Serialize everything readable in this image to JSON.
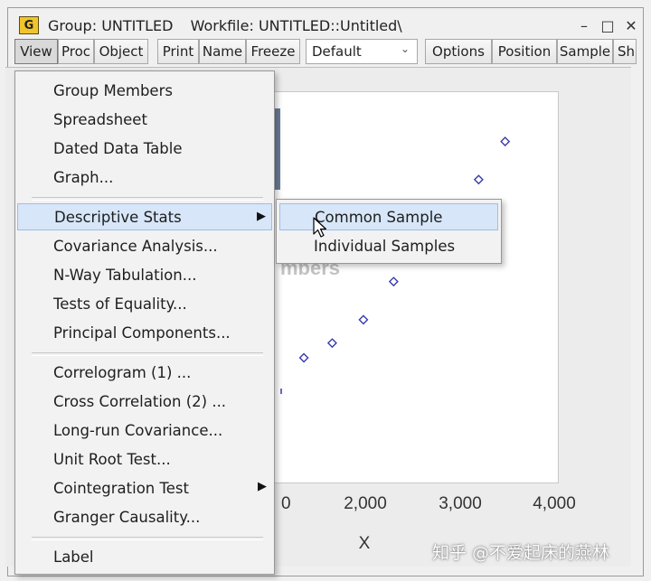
{
  "window": {
    "app_icon_letter": "G",
    "group_title": "Group: UNTITLED",
    "workfile_title": "Workfile: UNTITLED::Untitled\\",
    "minimize_glyph": "–",
    "maximize_glyph": "□",
    "close_glyph": "✕"
  },
  "toolbar": {
    "view": "View",
    "proc": "Proc",
    "object": "Object",
    "print": "Print",
    "name": "Name",
    "freeze": "Freeze",
    "display_mode": "Default",
    "options": "Options",
    "position": "Position",
    "sample": "Sample",
    "sh": "Sh"
  },
  "view_menu": {
    "items": [
      {
        "label": "Group Members"
      },
      {
        "label": "Spreadsheet"
      },
      {
        "label": "Dated Data Table"
      },
      {
        "label": "Graph..."
      },
      {
        "label": "Descriptive Stats",
        "submenu": true,
        "highlighted": true
      },
      {
        "label": "Covariance Analysis..."
      },
      {
        "label": "N-Way Tabulation..."
      },
      {
        "label": "Tests of Equality..."
      },
      {
        "label": "Principal Components..."
      },
      {
        "label": "Correlogram (1) ..."
      },
      {
        "label": "Cross Correlation (2) ..."
      },
      {
        "label": "Long-run Covariance..."
      },
      {
        "label": "Unit Root Test..."
      },
      {
        "label": "Cointegration Test",
        "submenu": true
      },
      {
        "label": "Granger Causality..."
      },
      {
        "label": "Label"
      }
    ]
  },
  "descriptive_stats_submenu": {
    "items": [
      {
        "label": "Common Sample",
        "highlighted": true
      },
      {
        "label": "Individual Samples"
      }
    ]
  },
  "graph": {
    "partial_x_tick": "0",
    "ghost_text": "mbers"
  },
  "chart_data": {
    "type": "scatter",
    "xlabel": "X",
    "ylabel": "",
    "x_ticks": [
      "0",
      "2,000",
      "3,000",
      "4,000"
    ],
    "xlim": [
      1000,
      4000
    ],
    "marker_color": "#3a3ab0",
    "visible_points": [
      {
        "x": 1350,
        "y": 1.0
      },
      {
        "x": 1650,
        "y": 1.12
      },
      {
        "x": 1980,
        "y": 1.31
      },
      {
        "x": 2300,
        "y": 1.62
      },
      {
        "x": 3200,
        "y": 2.45
      },
      {
        "x": 3480,
        "y": 2.76
      }
    ]
  },
  "watermark": "知乎 @不爱起床的燕林"
}
